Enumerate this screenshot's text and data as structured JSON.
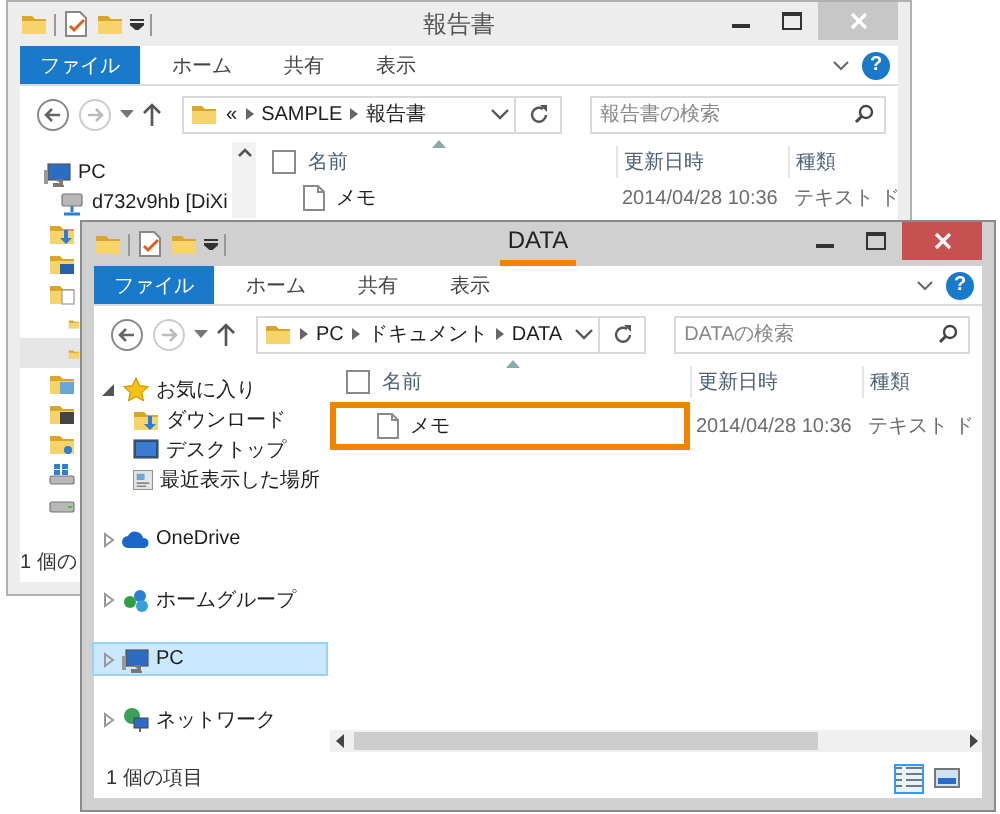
{
  "windows": [
    {
      "title": "報告書",
      "active": false,
      "title_highlighted": false,
      "tabs": [
        {
          "label": "ファイル",
          "selected": true
        },
        {
          "label": "ホーム",
          "selected": false
        },
        {
          "label": "共有",
          "selected": false
        },
        {
          "label": "表示",
          "selected": false
        }
      ],
      "help": "?",
      "address": {
        "overflow": "«",
        "crumbs": [
          "SAMPLE",
          "報告書"
        ]
      },
      "search": {
        "placeholder": "報告書の検索"
      },
      "sidebar_scrollbar": true,
      "sidebar": [
        {
          "label": "PC",
          "kind": "pc",
          "selected": false,
          "children": [
            {
              "label": "d732v9hb [DiXi",
              "kind": "net-drive",
              "selected": false
            },
            {
              "kind": "folder-down",
              "selected": false
            },
            {
              "kind": "folder-desktop",
              "selected": false
            },
            {
              "kind": "folder-doc",
              "selected": false,
              "children": [
                {
                  "kind": "folder",
                  "selected": false
                },
                {
                  "kind": "folder",
                  "selected": true
                }
              ]
            },
            {
              "kind": "folder-pic",
              "selected": false
            },
            {
              "kind": "folder-video",
              "selected": false
            },
            {
              "kind": "folder-music",
              "selected": false
            },
            {
              "kind": "drive-win",
              "selected": false
            },
            {
              "kind": "drive",
              "selected": false
            }
          ]
        }
      ],
      "select_all": {
        "checked": false
      },
      "columns": [
        "名前",
        "更新日時",
        "種類"
      ],
      "files": [
        {
          "name": "メモ",
          "modified": "2014/04/28 10:36",
          "type": "テキスト ド",
          "highlighted": false
        }
      ],
      "status": "1 個の"
    },
    {
      "title": "DATA",
      "active": true,
      "title_highlighted": true,
      "tabs": [
        {
          "label": "ファイル",
          "selected": true
        },
        {
          "label": "ホーム",
          "selected": false
        },
        {
          "label": "共有",
          "selected": false
        },
        {
          "label": "表示",
          "selected": false
        }
      ],
      "help": "?",
      "address": {
        "crumbs": [
          "PC",
          "ドキュメント",
          "DATA"
        ]
      },
      "search": {
        "placeholder": "DATAの検索"
      },
      "h_scrollbar": true,
      "sidebar": [
        {
          "label": "お気に入り",
          "kind": "star",
          "expanded": true,
          "selected": false,
          "children": [
            {
              "label": "ダウンロード",
              "kind": "folder-down",
              "selected": false
            },
            {
              "label": "デスクトップ",
              "kind": "desktop",
              "selected": false
            },
            {
              "label": "最近表示した場所",
              "kind": "recent",
              "selected": false
            }
          ]
        },
        {
          "label": "OneDrive",
          "kind": "cloud",
          "expanded": false,
          "selected": false
        },
        {
          "label": "ホームグループ",
          "kind": "homegroup",
          "expanded": false,
          "selected": false
        },
        {
          "label": "PC",
          "kind": "pc",
          "expanded": false,
          "selected": true
        },
        {
          "label": "ネットワーク",
          "kind": "network",
          "expanded": false,
          "selected": false
        }
      ],
      "select_all": {
        "checked": false
      },
      "columns": [
        "名前",
        "更新日時",
        "種類"
      ],
      "files": [
        {
          "name": "メモ",
          "modified": "2014/04/28 10:36",
          "type": "テキスト ド",
          "highlighted": true
        }
      ],
      "status": "1 個の項目",
      "view_buttons": true
    }
  ]
}
